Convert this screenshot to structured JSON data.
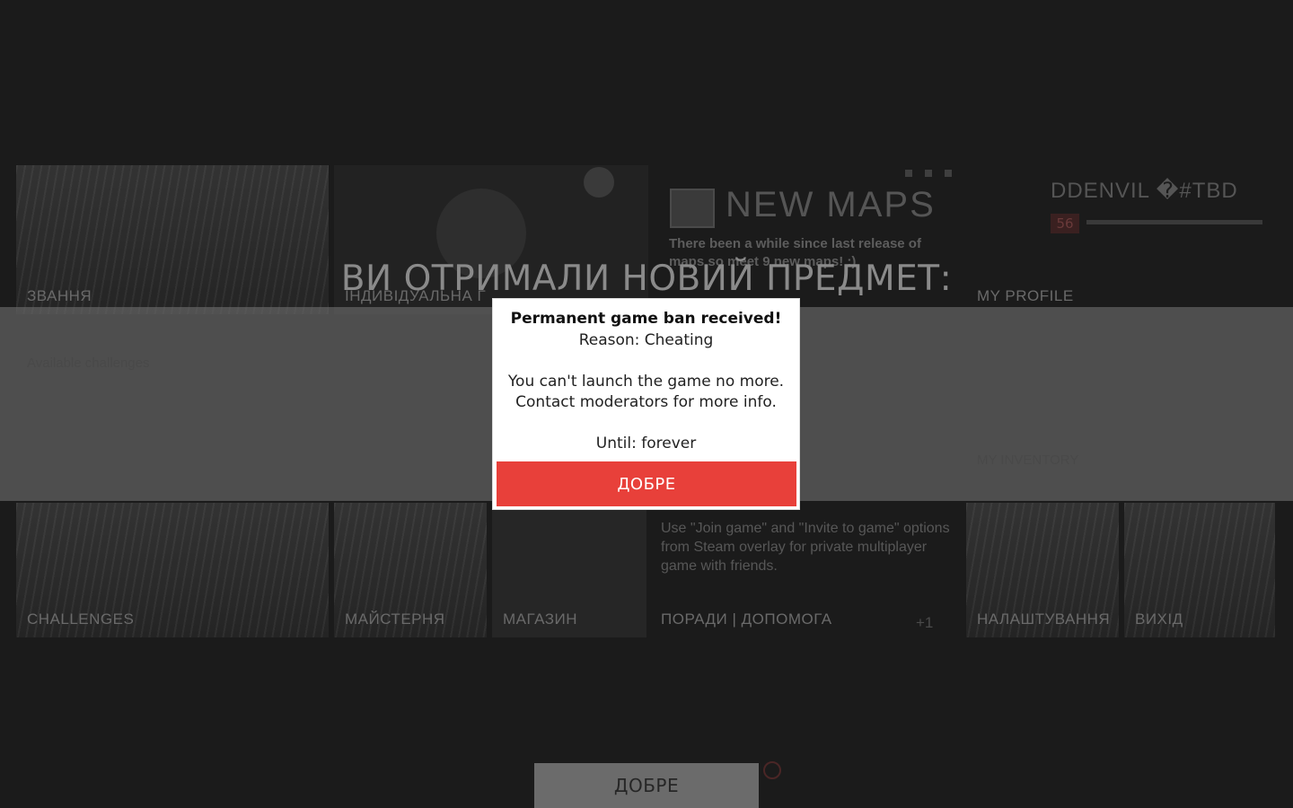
{
  "background": {
    "tiles": {
      "rank": "ЗВАННЯ",
      "individual": "ІНДИВІДУАЛЬНА Г",
      "my_profile": "MY PROFILE",
      "available_challenges": "Available challenges",
      "challenges": "CHALLENGES",
      "workshop": "МАЙСТЕРНЯ",
      "shop": "МАГАЗИН",
      "tips_help": "ПОРАДИ | ДОПОМОГА",
      "settings": "НАЛАШТУВАННЯ",
      "exit": "ВИХІД",
      "my_inventory": "MY INVENTORY"
    },
    "news": {
      "title": "NEW MAPS",
      "text": "There been a while since last release of maps so meet 9 new maps! :)"
    },
    "profile": {
      "name": "DDENVIL  �#TBD",
      "level": "56"
    },
    "join_hint": "Use \"Join game\" and \"Invite to game\" options from Steam overlay for private multiplayer game with friends.",
    "counter": "+1"
  },
  "reward": {
    "title": "ВИ ОТРИМАЛИ НОВИЙ ПРЕДМЕТ:",
    "ok_label": "ДОБРЕ"
  },
  "dialog": {
    "title": "Permanent game ban received!",
    "reason": "Reason: Cheating",
    "message_line1": "You can't launch the game no more.",
    "message_line2": "Contact moderators for more info.",
    "until": "Until: forever",
    "ok_label": "ДОБРЕ",
    "ok_color": "#e8403a"
  }
}
